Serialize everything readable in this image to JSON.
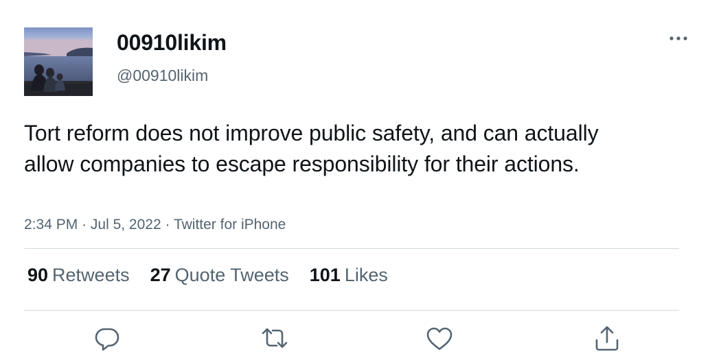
{
  "user": {
    "display_name": "00910likim",
    "handle": "@00910likim"
  },
  "tweet": {
    "text": "Tort reform does not improve public safety, and can actually allow companies to escape responsibility for their actions.",
    "time": "2:34 PM",
    "separator": "·",
    "date": "Jul 5, 2022",
    "source": "Twitter for iPhone"
  },
  "stats": {
    "retweets_count": "90",
    "retweets_label": "Retweets",
    "quotes_count": "27",
    "quotes_label": "Quote Tweets",
    "likes_count": "101",
    "likes_label": "Likes"
  },
  "icons": {
    "more": "more-horizontal-icon",
    "reply": "reply-icon",
    "retweet": "retweet-icon",
    "like": "heart-icon",
    "share": "share-icon"
  },
  "colors": {
    "text_primary": "#0f1419",
    "text_secondary": "#536471",
    "divider": "#cfd9de"
  }
}
